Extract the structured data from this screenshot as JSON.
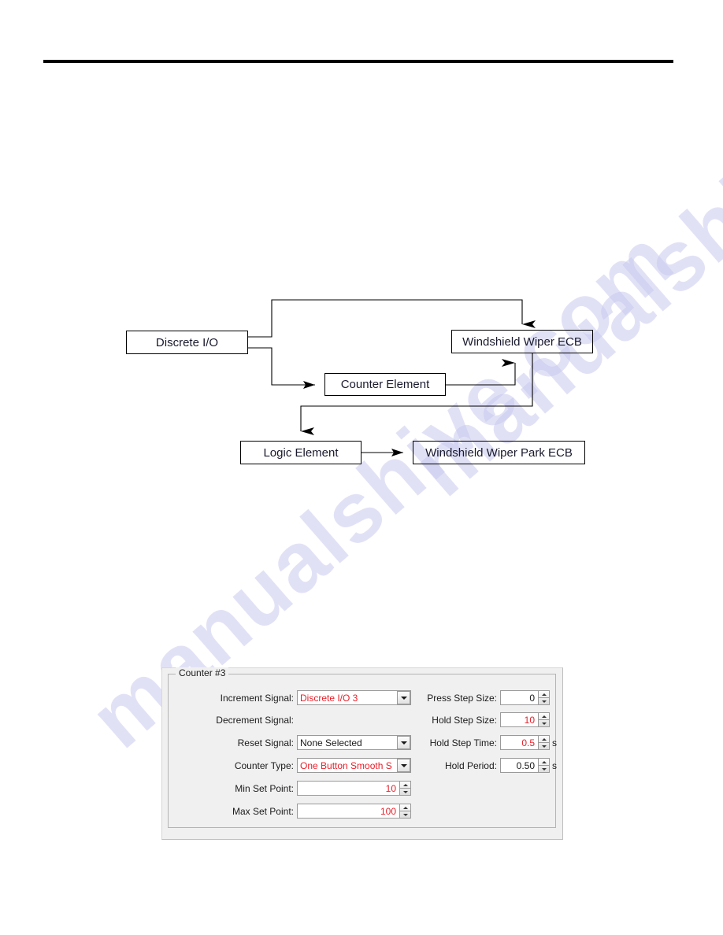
{
  "page": {
    "header_rule": "horizontal-rule",
    "watermark_text": "manualshive.com",
    "watermark_color": "#c9c9ef"
  },
  "diagram": {
    "type": "block-flow",
    "nodes": [
      {
        "id": "discrete-io",
        "label": "Discrete I/O"
      },
      {
        "id": "wiper-ecb",
        "label": "Windshield Wiper ECB"
      },
      {
        "id": "counter-element",
        "label": "Counter Element"
      },
      {
        "id": "logic-element",
        "label": "Logic Element"
      },
      {
        "id": "wiper-park-ecb",
        "label": "Windshield Wiper Park ECB"
      }
    ],
    "edges": [
      {
        "from": "discrete-io",
        "to": "wiper-ecb",
        "style": "orthogonal-top"
      },
      {
        "from": "discrete-io",
        "to": "counter-element",
        "style": "orthogonal-down"
      },
      {
        "from": "counter-element",
        "to": "wiper-ecb",
        "style": "orthogonal-up"
      },
      {
        "from": "wiper-ecb",
        "to": "logic-element",
        "style": "orthogonal-down-left"
      },
      {
        "from": "logic-element",
        "to": "wiper-park-ecb",
        "style": "straight"
      }
    ]
  },
  "counter_panel": {
    "group_title": "Counter #3",
    "left_fields": [
      {
        "label": "Increment Signal:",
        "control": "combobox",
        "value": "Discrete I/O 3",
        "value_color": "#e8202a"
      },
      {
        "label": "Decrement Signal:",
        "control": "none",
        "value": "",
        "value_color": "#1a1a1a"
      },
      {
        "label": "Reset Signal:",
        "control": "combobox",
        "value": "None Selected",
        "value_color": "#1a1a1a"
      },
      {
        "label": "Counter Type:",
        "control": "combobox",
        "value": "One Button Smooth S",
        "value_color": "#e8202a"
      },
      {
        "label": "Min Set Point:",
        "control": "spinbox",
        "value": "10",
        "value_color": "#e8202a"
      },
      {
        "label": "Max Set Point:",
        "control": "spinbox",
        "value": "100",
        "value_color": "#e8202a"
      }
    ],
    "right_fields": [
      {
        "label": "Press Step Size:",
        "control": "spinbox",
        "value": "0",
        "value_color": "#1a1a1a",
        "unit": ""
      },
      {
        "label": "Hold Step Size:",
        "control": "spinbox",
        "value": "10",
        "value_color": "#e8202a",
        "unit": ""
      },
      {
        "label": "Hold Step Time:",
        "control": "spinbox",
        "value": "0.5",
        "value_color": "#e8202a",
        "unit": "s"
      },
      {
        "label": "Hold Period:",
        "control": "spinbox",
        "value": "0.50",
        "value_color": "#1a1a1a",
        "unit": "s"
      }
    ]
  }
}
